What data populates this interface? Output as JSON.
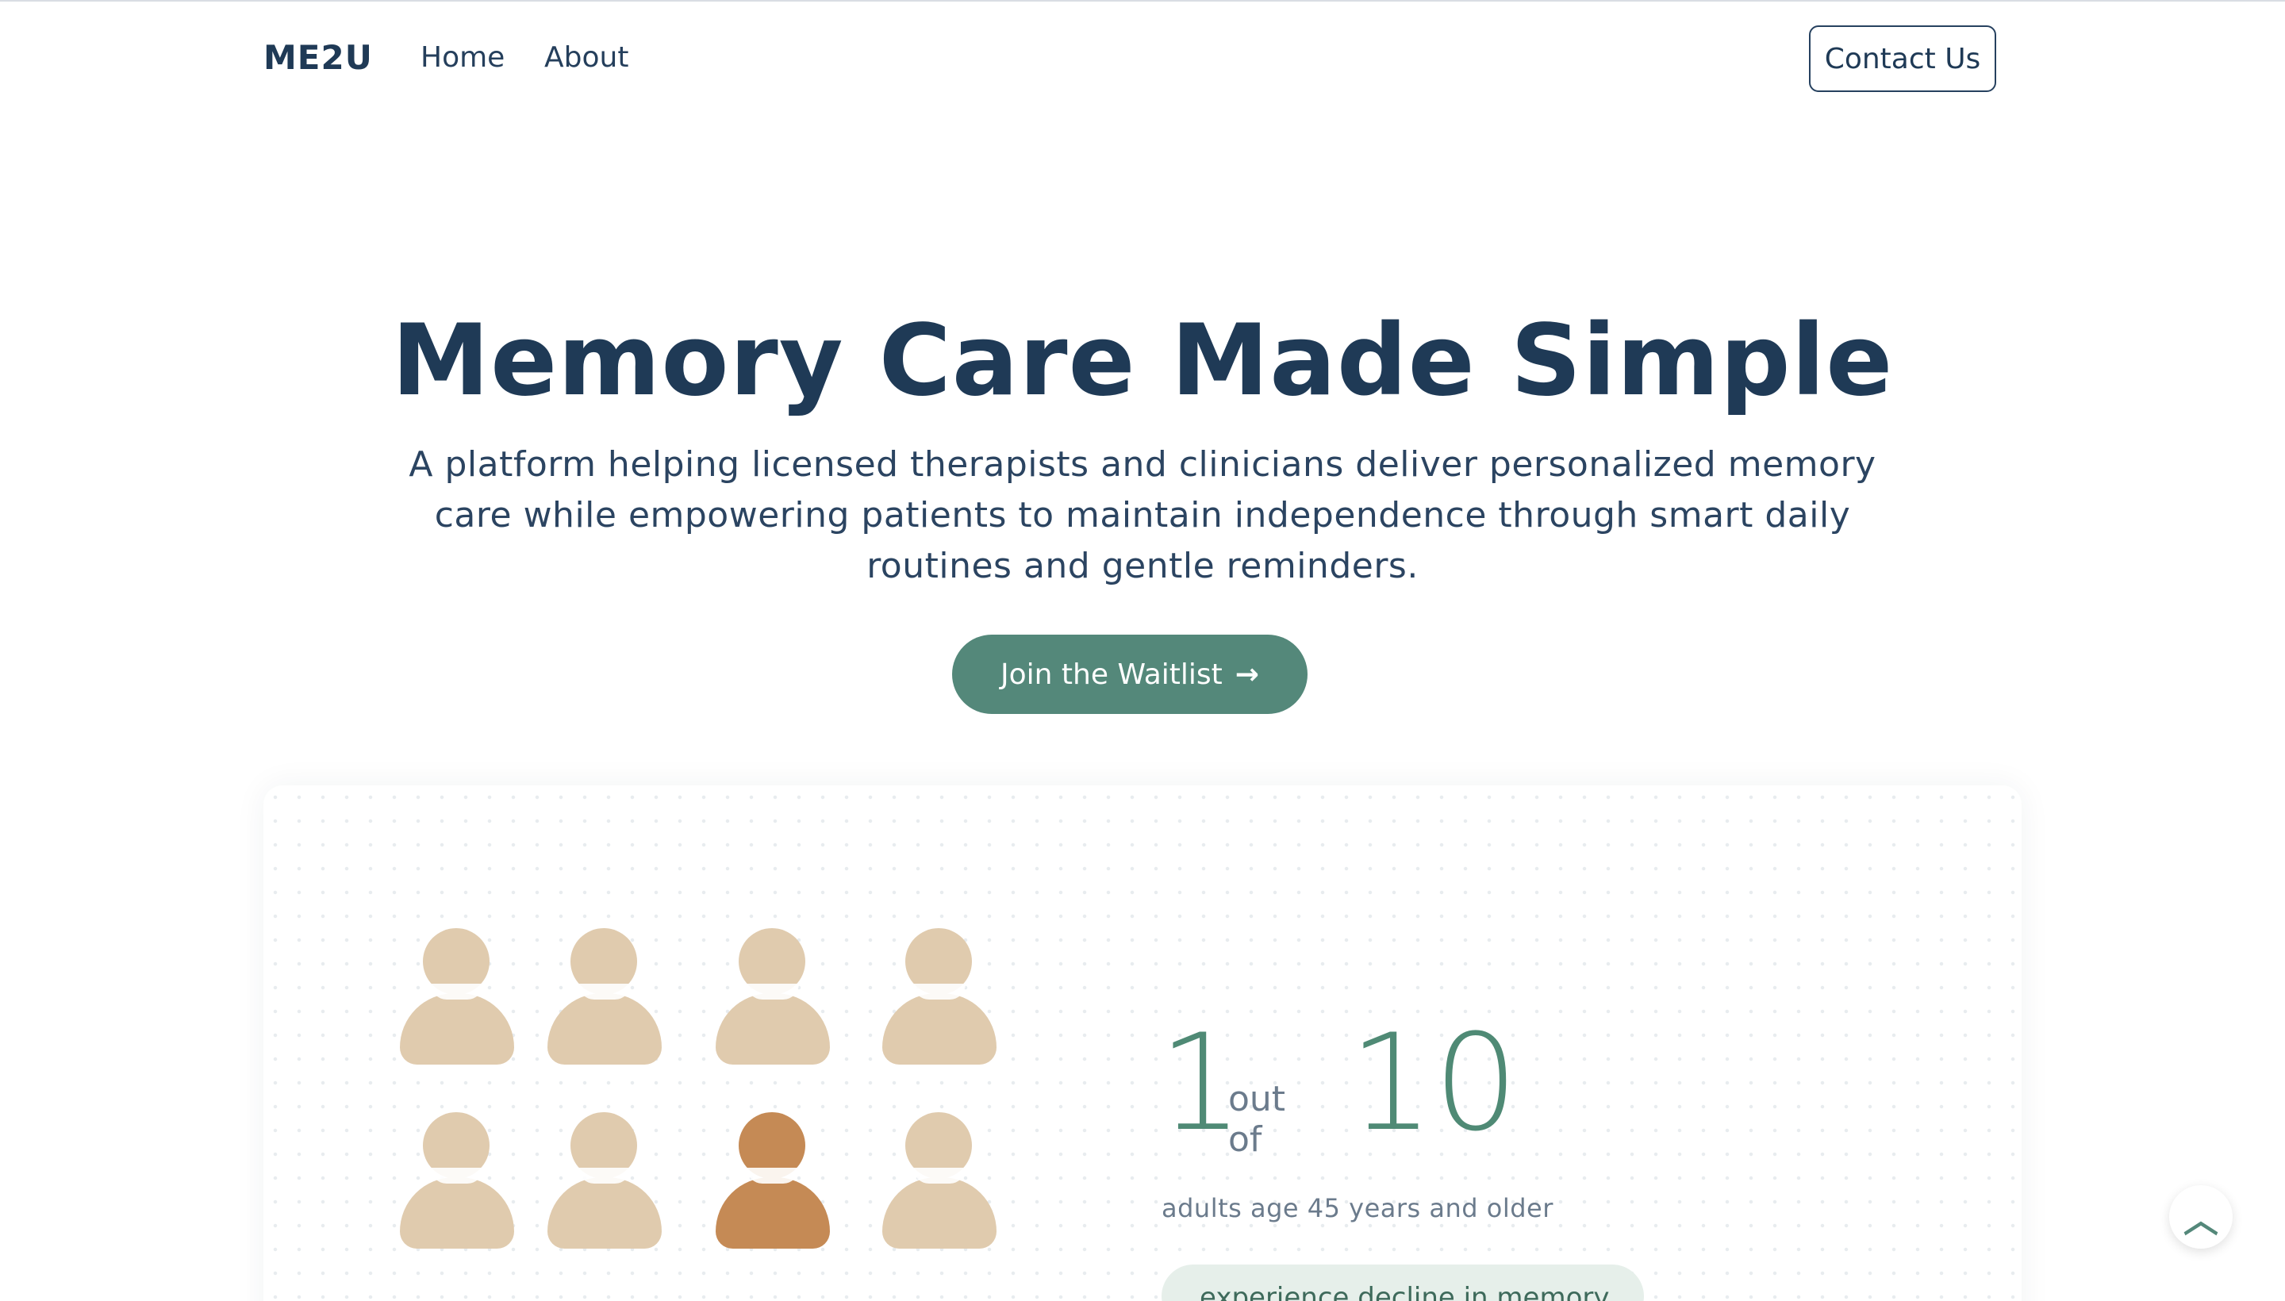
{
  "nav": {
    "logo": "ME2U",
    "links": [
      {
        "label": "Home"
      },
      {
        "label": "About"
      }
    ],
    "contact_label": "Contact Us"
  },
  "hero": {
    "title": "Memory Care Made Simple",
    "subtitle": "A platform helping licensed therapists and clinicians deliver personalized memory care while empowering patients to maintain independence through smart daily routines and gentle reminders.",
    "cta_label": "Join the Waitlist",
    "cta_icon": "arrow-right-icon"
  },
  "stat": {
    "numerator": "1",
    "connector": "out of",
    "denominator": "10",
    "caption": "adults age 45 years and older",
    "pill_text": "experience decline in memory",
    "people_total": 8,
    "people_highlighted_index": 6,
    "colors": {
      "neutral": "#e0cbae",
      "highlight": "#c58a55",
      "accent": "#4f8a75"
    }
  },
  "scroll_top": {
    "icon": "chevron-up-icon"
  }
}
